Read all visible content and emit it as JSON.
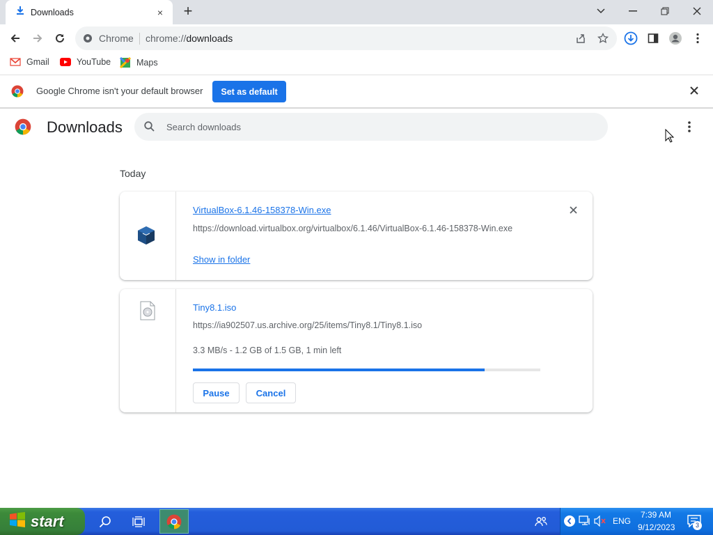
{
  "tab": {
    "title": "Downloads",
    "close": "×"
  },
  "newtab": "+",
  "omnibox": {
    "site_label": "Chrome",
    "url_scheme": "chrome://",
    "url_path": "downloads"
  },
  "bookmarks": [
    {
      "label": "Gmail",
      "icon": "gmail-icon"
    },
    {
      "label": "YouTube",
      "icon": "youtube-icon"
    },
    {
      "label": "Maps",
      "icon": "maps-icon"
    }
  ],
  "infobar": {
    "message": "Google Chrome isn't your default browser",
    "button": "Set as default"
  },
  "page": {
    "title": "Downloads",
    "search_placeholder": "Search downloads",
    "day_label": "Today"
  },
  "downloads": [
    {
      "filename": "VirtualBox-6.1.46-158378-Win.exe",
      "url": "https://download.virtualbox.org/virtualbox/6.1.46/VirtualBox-6.1.46-158378-Win.exe",
      "action": "Show in folder",
      "state": "complete"
    },
    {
      "filename": "Tiny8.1.iso",
      "url": "https://ia902507.us.archive.org/25/items/Tiny8.1/Tiny8.1.iso",
      "status": "3.3 MB/s - 1.2 GB of 1.5 GB, 1 min left",
      "progress": 0.84,
      "pause": "Pause",
      "cancel": "Cancel",
      "state": "in-progress"
    }
  ],
  "taskbar": {
    "start": "start",
    "lang": "ENG",
    "time": "7:39 AM",
    "date": "9/12/2023",
    "notifications": "3"
  },
  "colors": {
    "accent": "#1a73e8",
    "taskbar": "#245edc",
    "start": "#3c8a3a"
  }
}
